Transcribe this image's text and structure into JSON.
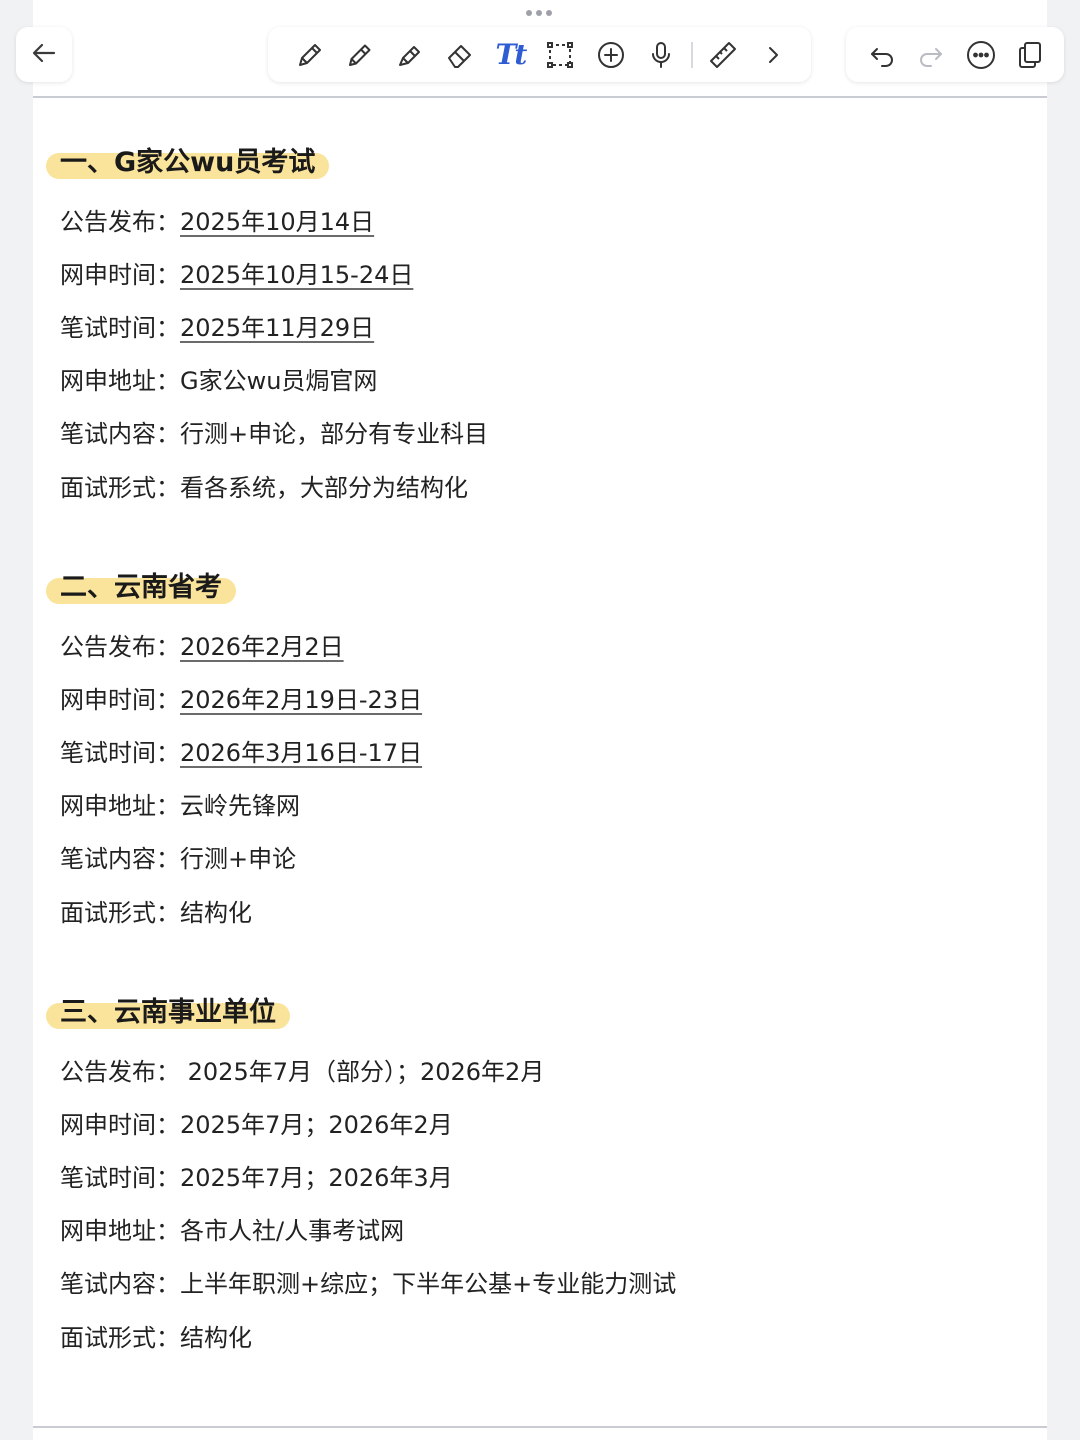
{
  "toolbar": {
    "back": "back-arrow-icon",
    "tools": [
      "pen-icon",
      "pencil-icon",
      "highlighter-icon",
      "eraser-icon",
      "text-tool-icon",
      "lasso-select-icon",
      "add-icon",
      "microphone-icon",
      "ruler-icon",
      "chevron-right-icon"
    ],
    "text_tool_label": "Tt",
    "right": [
      "undo-icon",
      "redo-icon",
      "more-icon",
      "pages-icon"
    ],
    "accent": "#2f5bd3"
  },
  "colors": {
    "highlight": "#fae39a",
    "page": "#ffffff",
    "background": "#f1f2f4"
  },
  "sections": [
    {
      "title": "一、G家公wu员考试",
      "rows": [
        {
          "label": "公告发布：",
          "value": "2025年10月14日"
        },
        {
          "label": "网申时间：",
          "value": "2025年10月15-24日"
        },
        {
          "label": "笔试时间：",
          "value": "2025年11月29日"
        },
        {
          "label": "网申地址：",
          "value": "G家公wu员焗官网"
        },
        {
          "label": "笔试内容：",
          "value": "行测+申论，部分有专业科目"
        },
        {
          "label": "面试形式：",
          "value": "看各系统，大部分为结构化"
        }
      ]
    },
    {
      "title": "二、云南省考",
      "rows": [
        {
          "label": "公告发布：",
          "value": "2026年2月2日"
        },
        {
          "label": "网申时间：",
          "value": "2026年2月19日-23日"
        },
        {
          "label": "笔试时间：",
          "value": "2026年3月16日-17日"
        },
        {
          "label": "网申地址：",
          "value": "云岭先锋网"
        },
        {
          "label": "笔试内容：",
          "value": "行测+申论"
        },
        {
          "label": "面试形式：",
          "value": "结构化"
        }
      ]
    },
    {
      "title": "三、云南事业单位",
      "rows": [
        {
          "label": "公告发布：",
          "value": " 2025年7月（部分）；2026年2月"
        },
        {
          "label": "网申时间：",
          "value": "2025年7月；2026年2月"
        },
        {
          "label": "笔试时间：",
          "value": "2025年7月；2026年3月"
        },
        {
          "label": "网申地址：",
          "value": "各市人社/人事考试网"
        },
        {
          "label": "笔试内容：",
          "value": "上半年职测+综应；下半年公基+专业能力测试"
        },
        {
          "label": "面试形式：",
          "value": "结构化"
        }
      ]
    }
  ]
}
